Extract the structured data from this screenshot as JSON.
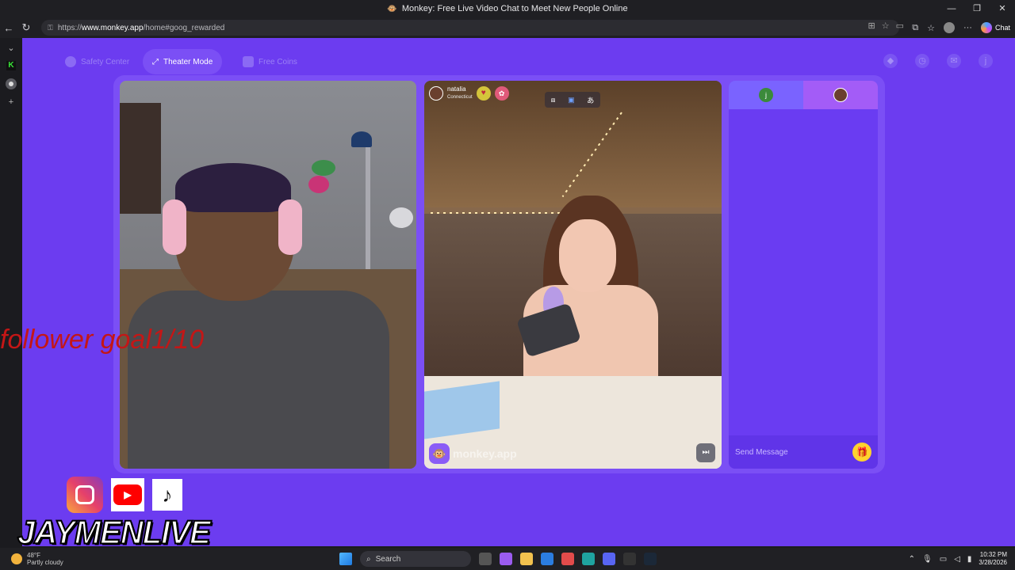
{
  "window": {
    "title": "Monkey: Free Live Video Chat to Meet New People Online"
  },
  "browser": {
    "url_prefix": "https://",
    "url_domain": "www.monkey.app",
    "url_path": "/home#goog_rewarded",
    "chat_label": "Chat"
  },
  "nav": {
    "safety_label": "Safety Center",
    "theater_label": "Theater Mode",
    "coins_label": "Free Coins"
  },
  "user_badge": "j",
  "match": {
    "name": "natalia",
    "location": "Connecticut"
  },
  "brand": {
    "watermark": "monkey.app"
  },
  "chat": {
    "tab_user_initial": "j",
    "placeholder": "Send Message"
  },
  "overlay": {
    "goal": "follower goal1/10",
    "streamer": "JAYMENLIVE"
  },
  "taskbar": {
    "weather_temp": "48°F",
    "weather_desc": "Partly cloudy",
    "search_label": "Search",
    "time": "10:32 PM",
    "date": "3/28/2026"
  },
  "colors": {
    "page_bg": "#6c3cf0",
    "accent": "#7b4ff5",
    "gift": "#ffd22e",
    "goal_text": "#c41616"
  }
}
